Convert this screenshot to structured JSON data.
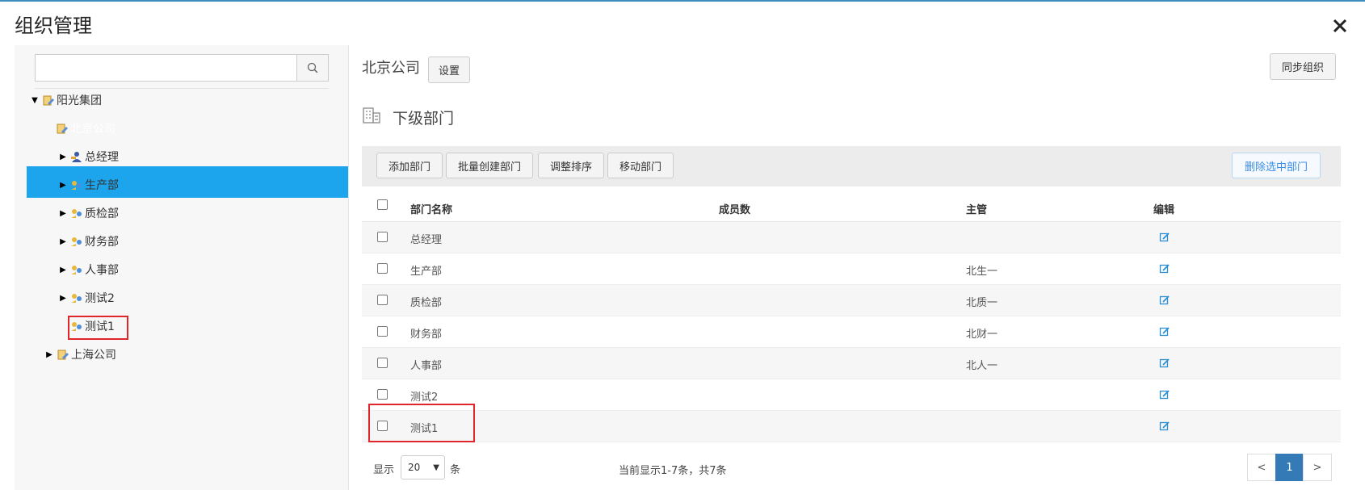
{
  "dialog": {
    "title": "组织管理",
    "close_glyph": "✕"
  },
  "search": {
    "value": "",
    "placeholder": "",
    "icon": "search-icon"
  },
  "tree": {
    "root": "阳光集团",
    "selected": "北京公司",
    "children": [
      {
        "label": "总经理",
        "icon": "person-key-icon"
      },
      {
        "label": "生产部",
        "icon": "dept-icon"
      },
      {
        "label": "质检部",
        "icon": "dept-icon"
      },
      {
        "label": "财务部",
        "icon": "dept-icon"
      },
      {
        "label": "人事部",
        "icon": "dept-icon"
      },
      {
        "label": "测试2",
        "icon": "dept-icon"
      },
      {
        "label": "测试1",
        "icon": "dept-icon"
      }
    ],
    "sibling": "上海公司"
  },
  "header": {
    "company": "北京公司",
    "settings": "设置",
    "sync": "同步组织"
  },
  "section": {
    "title": "下级部门"
  },
  "toolbar": {
    "add": "添加部门",
    "batch_create": "批量创建部门",
    "reorder": "调整排序",
    "move": "移动部门",
    "delete_selected": "删除选中部门"
  },
  "table": {
    "headers": {
      "name": "部门名称",
      "members": "成员数",
      "manager": "主管",
      "edit": "编辑"
    },
    "rows": [
      {
        "name": "总经理",
        "members": "",
        "manager": ""
      },
      {
        "name": "生产部",
        "members": "",
        "manager": "北生一"
      },
      {
        "name": "质检部",
        "members": "",
        "manager": "北质一"
      },
      {
        "name": "财务部",
        "members": "",
        "manager": "北财一"
      },
      {
        "name": "人事部",
        "members": "",
        "manager": "北人一"
      },
      {
        "name": "测试2",
        "members": "",
        "manager": ""
      },
      {
        "name": "测试1",
        "members": "",
        "manager": ""
      }
    ]
  },
  "footer": {
    "show_label": "显示",
    "page_size": "20",
    "unit": "条",
    "summary": "当前显示1-7条，共7条",
    "prev": "<",
    "current_page": "1",
    "next": ">"
  },
  "colors": {
    "accent": "#1ca5ed",
    "highlight": "#e0262b",
    "primary": "#337ab7"
  }
}
